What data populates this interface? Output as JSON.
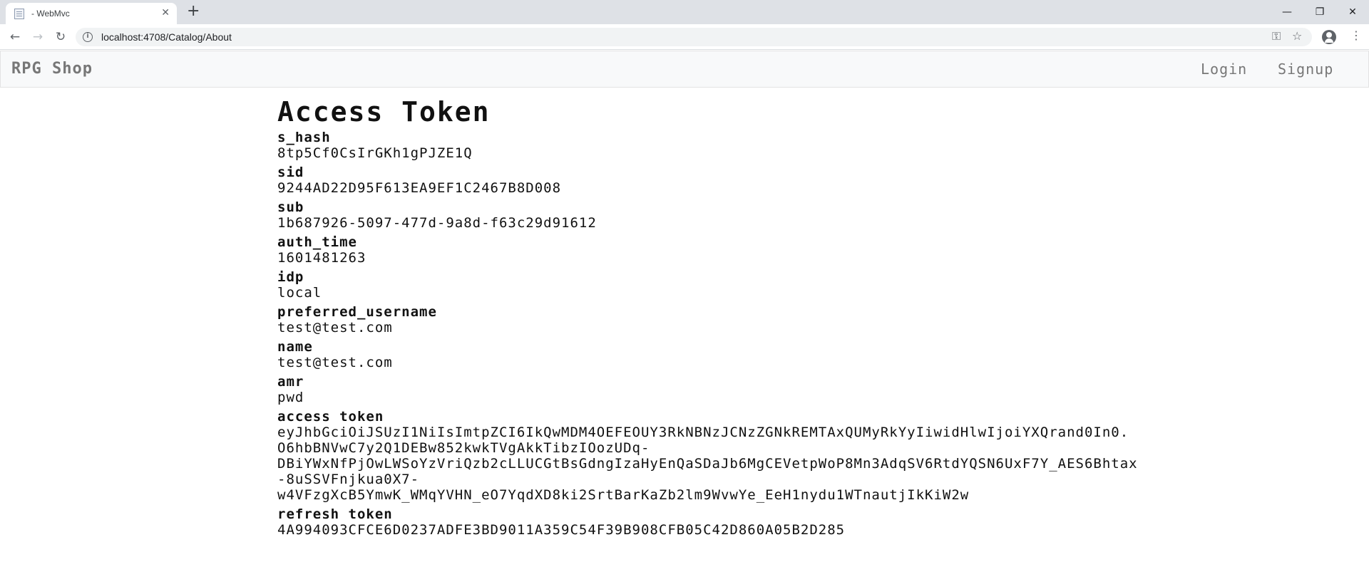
{
  "browser": {
    "tab_title": "- WebMvc",
    "tab_close": "✕",
    "new_tab": "+",
    "url": "localhost:4708/Catalog/About",
    "win_minimize": "—",
    "win_restore": "❐",
    "win_close": "✕"
  },
  "site": {
    "brand": "RPG Shop",
    "nav": {
      "login": "Login",
      "signup": "Signup"
    }
  },
  "page": {
    "title": "Access Token",
    "claims": [
      {
        "key": "s_hash",
        "value": "8tp5Cf0CsIrGKh1gPJZE1Q"
      },
      {
        "key": "sid",
        "value": "9244AD22D95F613EA9EF1C2467B8D008"
      },
      {
        "key": "sub",
        "value": "1b687926-5097-477d-9a8d-f63c29d91612"
      },
      {
        "key": "auth_time",
        "value": "1601481263"
      },
      {
        "key": "idp",
        "value": "local"
      },
      {
        "key": "preferred_username",
        "value": "test@test.com"
      },
      {
        "key": "name",
        "value": "test@test.com"
      },
      {
        "key": "amr",
        "value": "pwd"
      }
    ],
    "access_token": {
      "key": "access token",
      "lines": [
        "eyJhbGciOiJSUzI1NiIsImtpZCI6IkQwMDM4OEFEOUY3RkNBNzJCNzZGNkREMTAxQUMyRkYyIiwidHlwIjoiYXQrand0In0.",
        "O6hbBNVwC7y2Q1DEBw852kwkTVgAkkTibzIOozUDq-",
        "DBiYWxNfPjOwLWSoYzVriQzb2cLLUCGtBsGdngIzaHyEnQaSDaJb6MgCEVetpWoP8Mn3AdqSV6RtdYQSN6UxF7Y_AES6Bhtax",
        "-8uSSVFnjkua0X7-",
        "w4VFzgXcB5YmwK_WMqYVHN_eO7YqdXD8ki2SrtBarKaZb2lm9WvwYe_EeH1nydu1WTnautjIkKiW2w"
      ]
    },
    "refresh_token": {
      "key": "refresh token",
      "value": "4A994093CFCE6D0237ADFE3BD9011A359C54F39B908CFB05C42D860A05B2D285"
    }
  }
}
